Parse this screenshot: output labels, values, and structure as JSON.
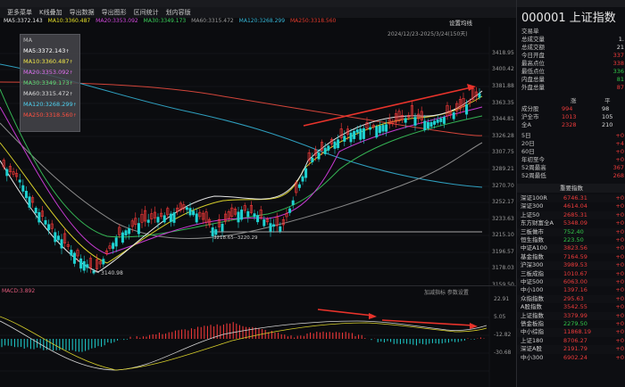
{
  "toolbar": {
    "items": [
      "更多菜单",
      "K线叠加",
      "导出数据",
      "导出图形",
      "区间统计",
      "划内容版"
    ]
  },
  "chart": {
    "ma_legend": [
      {
        "label": "MA5:3372.143",
        "color": "#e8e8e8"
      },
      {
        "label": "MA10:3360.487",
        "color": "#e6e02a"
      },
      {
        "label": "MA20:3353.092",
        "color": "#d44adf"
      },
      {
        "label": "MA30:3349.173",
        "color": "#3ad25a"
      },
      {
        "label": "MA60:3315.472",
        "color": "#9a9a9a"
      },
      {
        "label": "MA120:3268.299",
        "color": "#36b6d6"
      },
      {
        "label": "MA250:3318.560",
        "color": "#e23a2c"
      }
    ],
    "settings_label": "设置均线",
    "range_text": "2024/12/23-2025/3/24(150天)",
    "ma_box": {
      "title": "MA",
      "items": [
        {
          "label": "MA5:3372.143",
          "color": "#ffffff",
          "arrow": "↑"
        },
        {
          "label": "MA10:3360.487",
          "color": "#f0e64a",
          "arrow": "↑"
        },
        {
          "label": "MA20:3353.092",
          "color": "#e070f0",
          "arrow": "↑"
        },
        {
          "label": "MA30:3349.173",
          "color": "#5ee07a",
          "arrow": "↑"
        },
        {
          "label": "MA60:3315.472",
          "color": "#dddddd",
          "arrow": "↑"
        },
        {
          "label": "MA120:3268.299",
          "color": "#4fd0f0",
          "arrow": "↑"
        },
        {
          "label": "MA250:3318.560",
          "color": "#ff5040",
          "arrow": "↑"
        }
      ]
    },
    "price_ticks": [
      "3418.95",
      "3400.42",
      "3381.88",
      "3363.35",
      "3344.81",
      "3326.28",
      "3307.75",
      "3289.21",
      "3270.70",
      "3252.17",
      "3233.63",
      "3215.10",
      "3196.57",
      "3178.03",
      "3159.50"
    ],
    "annotations": {
      "low": "3140.98",
      "flat": "3218.65--3220.29"
    },
    "macd_label": "MACD:3.892",
    "macd_tools": "加减指标  参数设置",
    "macd_ticks": [
      "22.91",
      "5.05",
      "-12.82",
      "-30.68"
    ]
  },
  "panel": {
    "code": "000001 上证指数",
    "stats": [
      {
        "label": "交易单",
        "value": "",
        "cls": "white"
      },
      {
        "label": "总成交量",
        "value": "1.",
        "cls": "white"
      },
      {
        "label": "总成交额",
        "value": "21",
        "cls": "white"
      },
      {
        "label": "今日开盘",
        "value": "337",
        "cls": "red"
      },
      {
        "label": "最高点位",
        "value": "338",
        "cls": "red"
      },
      {
        "label": "最低点位",
        "value": "336",
        "cls": "green"
      },
      {
        "label": "内盘总量",
        "value": "81",
        "cls": "green"
      },
      {
        "label": "外盘总量",
        "value": "87",
        "cls": "red"
      }
    ],
    "breadth_header": [
      "",
      "涨",
      "平"
    ],
    "breadth": [
      {
        "label": "成分股",
        "up": "994",
        "flat": "98"
      },
      {
        "label": "沪全市",
        "up": "1013",
        "flat": "105"
      },
      {
        "label": "全A",
        "up": "2328",
        "flat": "210"
      }
    ],
    "periods": [
      {
        "label": "5日",
        "value": "+0"
      },
      {
        "label": "20日",
        "value": "+4"
      },
      {
        "label": "60日",
        "value": "+0"
      },
      {
        "label": "年初至今",
        "value": "+0"
      },
      {
        "label": "52周最高",
        "value": "367"
      },
      {
        "label": "52周最低",
        "value": "268"
      }
    ],
    "indices_header": "重要指数",
    "indices": [
      {
        "name": "深证100R",
        "price": "6746.31",
        "chg": "+0"
      },
      {
        "name": "深证300",
        "price": "4614.04",
        "chg": "+0"
      },
      {
        "name": "上证50",
        "price": "2685.31",
        "chg": "+0"
      },
      {
        "name": "东方财富全A",
        "price": "5348.09",
        "chg": "+0"
      },
      {
        "name": "三板做市",
        "price": "752.40",
        "chg": "+0"
      },
      {
        "name": "恒生指数",
        "price": "223.50",
        "chg": "+0"
      },
      {
        "name": "中证A100",
        "price": "3823.56",
        "chg": "+0"
      },
      {
        "name": "基金指数",
        "price": "7164.59",
        "chg": "+0"
      },
      {
        "name": "沪深300",
        "price": "3989.53",
        "chg": "+0"
      },
      {
        "name": "三板成指",
        "price": "1010.67",
        "chg": "+0"
      },
      {
        "name": "中证500",
        "price": "6063.00",
        "chg": "+0"
      },
      {
        "name": "中小100",
        "price": "1397.16",
        "chg": "+0"
      },
      {
        "name": "众指指数",
        "price": "295.63",
        "chg": "+0"
      },
      {
        "name": "A股指数",
        "price": "3542.55",
        "chg": "+0"
      },
      {
        "name": "上证指数",
        "price": "3379.99",
        "chg": "+0"
      },
      {
        "name": "债金板指",
        "price": "2279.50",
        "chg": "+0"
      },
      {
        "name": "中小综指",
        "price": "11868.19",
        "chg": "+0"
      },
      {
        "name": "上证180",
        "price": "8706.27",
        "chg": "+0"
      },
      {
        "name": "深证A股",
        "price": "2191.79",
        "chg": "+0"
      },
      {
        "name": "中小300",
        "price": "6902.24",
        "chg": "+0"
      }
    ]
  }
}
